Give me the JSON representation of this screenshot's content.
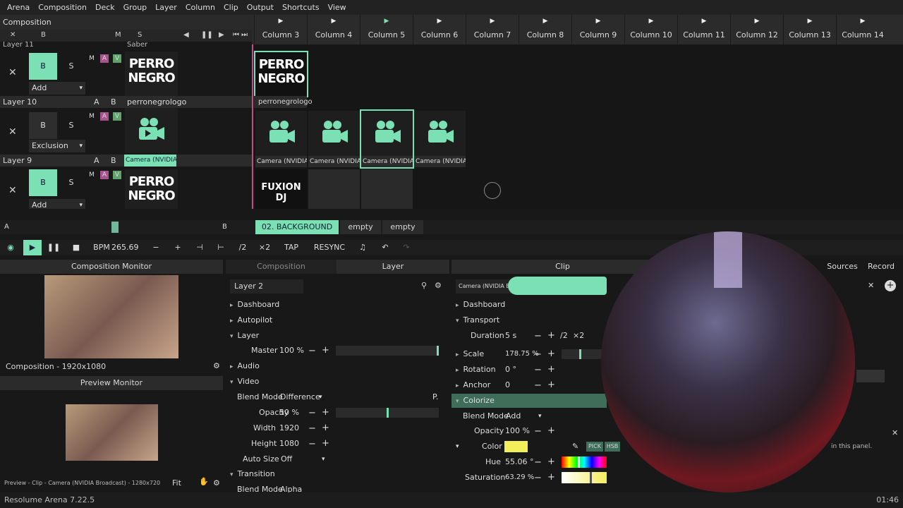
{
  "menu": [
    "Arena",
    "Composition",
    "Deck",
    "Group",
    "Layer",
    "Column",
    "Clip",
    "Output",
    "Shortcuts",
    "View"
  ],
  "composition_label": "Composition",
  "layer_ctrl": {
    "x": "✕",
    "b": "B",
    "m": "M",
    "s": "S"
  },
  "columns": [
    "Column 3",
    "Column 4",
    "Column 5",
    "Column 6",
    "Column 7",
    "Column 8",
    "Column 9",
    "Column 10",
    "Column 11",
    "Column 12",
    "Column 13",
    "Column 14"
  ],
  "layers": [
    {
      "name": "Layer 11",
      "clipname": "Saber",
      "blend": "Add"
    },
    {
      "name": "Layer 10",
      "clipname": "perronegrologo",
      "blend": "Exclusion"
    },
    {
      "name": "Layer 9",
      "clipname": "Camera (NVIDIA B...",
      "blend": "Add"
    }
  ],
  "logo_text": "PERRO NEGRO",
  "clips": {
    "row1": [
      {
        "label": "perronegrologo"
      }
    ],
    "row2": [
      {
        "label": "Camera (NVIDIA B..."
      },
      {
        "label": "Camera (NVIDIA B..."
      },
      {
        "label": "Camera (NVIDIA B..."
      },
      {
        "label": "Camera (NVIDIA B..."
      }
    ],
    "row3": [
      {
        "label": "FUXION DJ"
      }
    ]
  },
  "deck": {
    "a": "A",
    "b": "B",
    "active": "02. BACKGROUND",
    "empty1": "empty",
    "empty2": "empty"
  },
  "transport": {
    "bpm_label": "BPM",
    "bpm": "265.69",
    "half": "/2",
    "double": "×2",
    "tap": "TAP",
    "resync": "RESYNC"
  },
  "comp_monitor": {
    "title": "Composition Monitor",
    "res": "Composition - 1920x1080"
  },
  "preview_monitor": {
    "title": "Preview Monitor",
    "info": "Preview - Clip - Camera (NVIDIA Broadcast) - 1280x720",
    "fit": "Fit"
  },
  "tabs": {
    "composition": "Composition",
    "layer": "Layer",
    "clip": "Clip",
    "sources": "Sources",
    "record": "Record"
  },
  "layer_panel": {
    "name": "Layer 2",
    "dashboard": "Dashboard",
    "autopilot": "Autopilot",
    "layer": "Layer",
    "master_label": "Master",
    "master": "100 %",
    "audio": "Audio",
    "video": "Video",
    "blend_label": "Blend Mode",
    "blend": "Difference",
    "opacity_label": "Opacity",
    "opacity": "50 %",
    "width_label": "Width",
    "width": "1920",
    "height_label": "Height",
    "height": "1080",
    "autosize_label": "Auto Size",
    "autosize": "Off",
    "transition": "Transition",
    "tblend_label": "Blend Mode",
    "tblend": "Alpha"
  },
  "clip_panel": {
    "name": "Camera (NVIDIA Broadcast)",
    "dashboard": "Dashboard",
    "transport": "Transport",
    "duration_label": "Duration",
    "duration": "5 s",
    "scale_label": "Scale",
    "scale": "178.75 %",
    "rotation_label": "Rotation",
    "rotation": "0 °",
    "anchor_label": "Anchor",
    "anchor": "0",
    "colorize": "Colorize",
    "blend_label": "Blend Mode",
    "blend": "Add",
    "opacity_label": "Opacity",
    "opacity": "100 %",
    "color_label": "Color",
    "pick": "PICK",
    "hsb": "HSB",
    "hue_label": "Hue",
    "hue": "55.06 °",
    "sat_label": "Saturation",
    "sat": "63.29 %",
    "sidenote": "in this panel."
  },
  "status": {
    "version": "Resolume Arena 7.22.5",
    "time": "01:46"
  },
  "colors": {
    "accent": "#7be0b4",
    "color_swatch": "#f4ee5a"
  }
}
